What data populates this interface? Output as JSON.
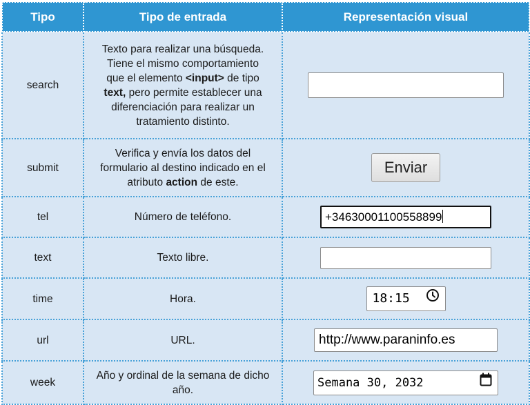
{
  "headers": {
    "tipo": "Tipo",
    "tipo_entrada": "Tipo de entrada",
    "representacion": "Representación visual"
  },
  "colors": {
    "header_bg": "#2f96d2",
    "cell_bg": "#d8e6f4",
    "border_dotted": "#47a1d8"
  },
  "rows": [
    {
      "tipo": "search",
      "desc_lines": [
        [
          "Texto para realizar una búsqueda."
        ],
        [
          "Tiene el mismo comportamiento"
        ],
        [
          "que el elemento ",
          "<input>",
          " de tipo"
        ],
        [
          "text,",
          " pero permite establecer una"
        ],
        [
          "diferenciación para realizar un"
        ],
        [
          "tratamiento distinto."
        ]
      ],
      "visual": {
        "kind": "search-input",
        "value": ""
      }
    },
    {
      "tipo": "submit",
      "desc_lines": [
        [
          "Verifica y envía los datos del"
        ],
        [
          "formulario al destino indicado en el"
        ],
        [
          "atributo ",
          "action",
          " de este."
        ]
      ],
      "visual": {
        "kind": "submit-button",
        "label": "Enviar"
      }
    },
    {
      "tipo": "tel",
      "desc_lines": [
        [
          "Número de teléfono."
        ]
      ],
      "visual": {
        "kind": "tel-input",
        "value": "+34630001100558899"
      }
    },
    {
      "tipo": "text",
      "desc_lines": [
        [
          "Texto libre."
        ]
      ],
      "visual": {
        "kind": "text-input",
        "value": ""
      }
    },
    {
      "tipo": "time",
      "desc_lines": [
        [
          "Hora."
        ]
      ],
      "visual": {
        "kind": "time-input",
        "value": "18:15",
        "icon": "clock-icon"
      }
    },
    {
      "tipo": "url",
      "desc_lines": [
        [
          "URL."
        ]
      ],
      "visual": {
        "kind": "url-input",
        "value": "http://www.paraninfo.es"
      }
    },
    {
      "tipo": "week",
      "desc_lines": [
        [
          "Año y ordinal de la semana de dicho"
        ],
        [
          "año."
        ]
      ],
      "visual": {
        "kind": "week-input",
        "value": "Semana 30, 2032",
        "icon": "calendar-icon"
      }
    }
  ]
}
